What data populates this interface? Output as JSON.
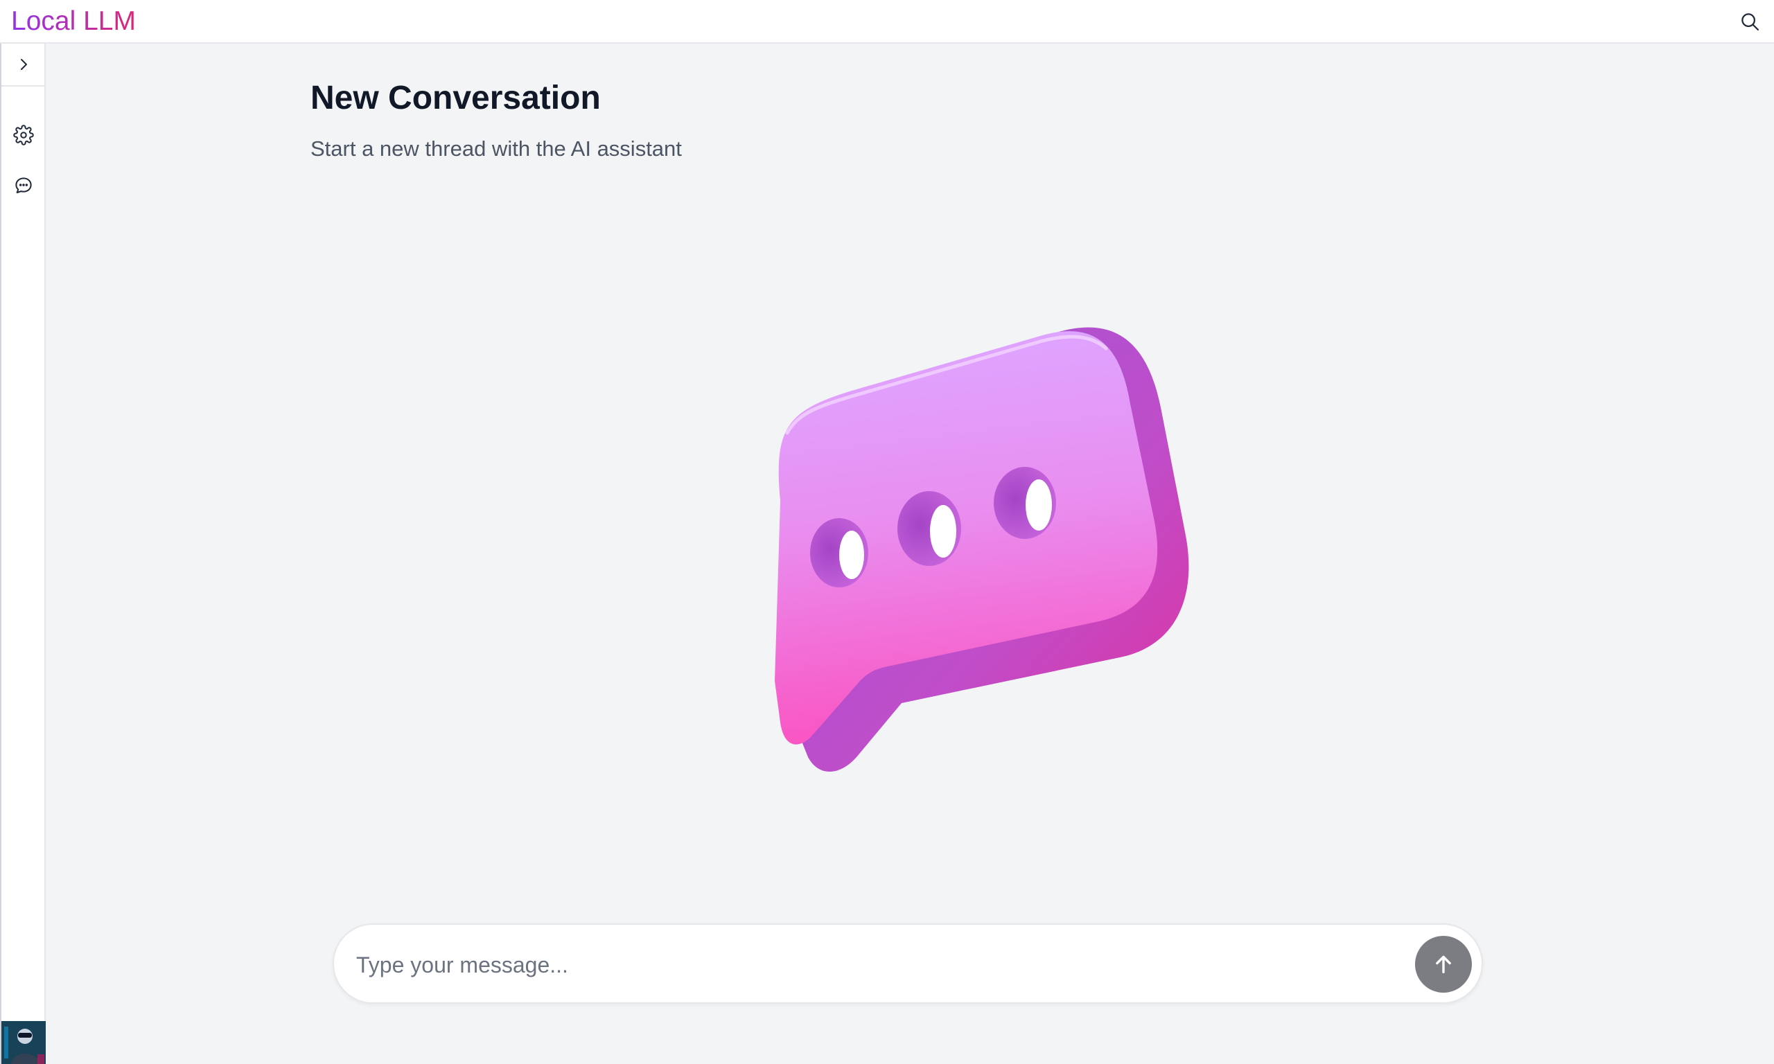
{
  "app": {
    "brand": "Local LLM"
  },
  "topbar": {
    "search_icon": "search-icon"
  },
  "sidebar": {
    "toggle_icon": "chevron-right-icon",
    "items": [
      {
        "icon": "gear-icon",
        "name": "settings"
      },
      {
        "icon": "chat-bubble-icon",
        "name": "conversations"
      }
    ],
    "avatar": "user-avatar"
  },
  "main": {
    "title": "New Conversation",
    "subtitle": "Start a new thread with the AI assistant",
    "hero_icon": "speech-bubble-illustration"
  },
  "composer": {
    "placeholder": "Type your message...",
    "value": "",
    "send_icon": "arrow-up-icon"
  },
  "colors": {
    "brand_start": "#9333ea",
    "brand_end": "#db2777",
    "background": "#f3f4f6",
    "send_button": "#7b7d82"
  }
}
